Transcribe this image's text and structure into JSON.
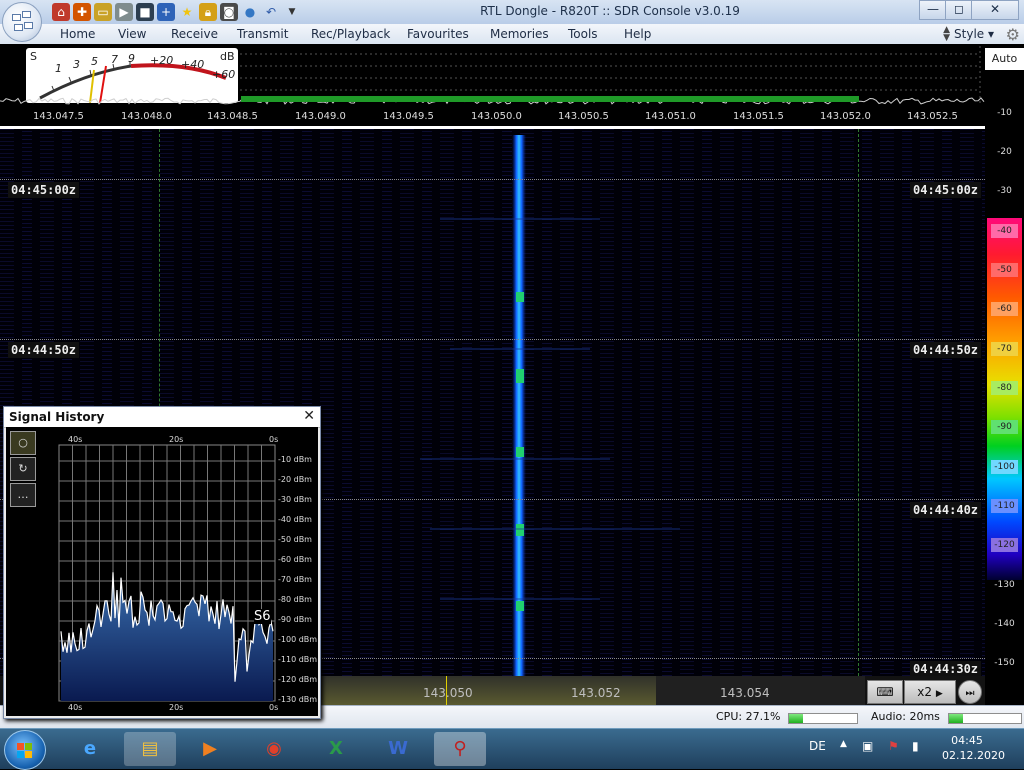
{
  "window": {
    "title": "RTL Dongle - R820T :: SDR Console v3.0.19",
    "minimize": "—",
    "restore": "◻",
    "close": "✕"
  },
  "ribbon": {
    "tabs": [
      "Home",
      "View",
      "Receive",
      "Transmit",
      "Rec/Playback",
      "Favourites",
      "Memories",
      "Tools",
      "Help"
    ],
    "style_label": "Style"
  },
  "smeter": {
    "s_label": "S",
    "db_label": "dB",
    "s_marks": [
      "1",
      "3",
      "5",
      "7",
      "9"
    ],
    "db_marks": [
      "+20",
      "+40",
      "+60"
    ]
  },
  "freq_axis": [
    "143.047.5",
    "143.048.0",
    "143.048.5",
    "143.049.0",
    "143.049.5",
    "143.050.0",
    "143.050.5",
    "143.051.0",
    "143.051.5",
    "143.052.0",
    "143.052.5"
  ],
  "waterfall": {
    "time_labels": [
      "04:45:00z",
      "04:44:50z",
      "04:44:40z",
      "04:44:30z"
    ]
  },
  "right_scale": {
    "auto_label": "Auto",
    "levels": [
      "-10",
      "-20",
      "-30",
      "-130",
      "-140",
      "-150"
    ],
    "colorbar_levels": [
      "-40",
      "-50",
      "-60",
      "-70",
      "-80",
      "-90",
      "-100",
      "-110",
      "-120"
    ]
  },
  "tuning": {
    "labels": [
      "143.050",
      "143.052",
      "143.054"
    ],
    "zoom_label": "x2"
  },
  "status": {
    "cpu_text": "CPU: 27.1%",
    "cpu_fill": 0.2,
    "audio_text": "Audio: 20ms",
    "audio_fill": 0.2
  },
  "signal_history": {
    "title": "Signal History",
    "time_top": [
      "40s",
      "20s",
      "0s"
    ],
    "time_bottom": [
      "40s",
      "20s",
      "0s"
    ],
    "db_labels": [
      "-10 dBm",
      "-20 dBm",
      "-30 dBm",
      "-40 dBm",
      "-50 dBm",
      "-60 dBm",
      "-70 dBm",
      "-80 dBm",
      "-90 dBm",
      "-100 dBm",
      "-110 dBm",
      "-120 dBm",
      "-130 dBm"
    ],
    "s_readout": "S6"
  },
  "taskbar": {
    "items": [
      "Internet Explorer",
      "Windows Explorer",
      "Media Player",
      "Chrome",
      "Excel",
      "Word",
      "SDR Console"
    ],
    "language": "DE",
    "time": "04:45",
    "date": "02.12.2020"
  }
}
